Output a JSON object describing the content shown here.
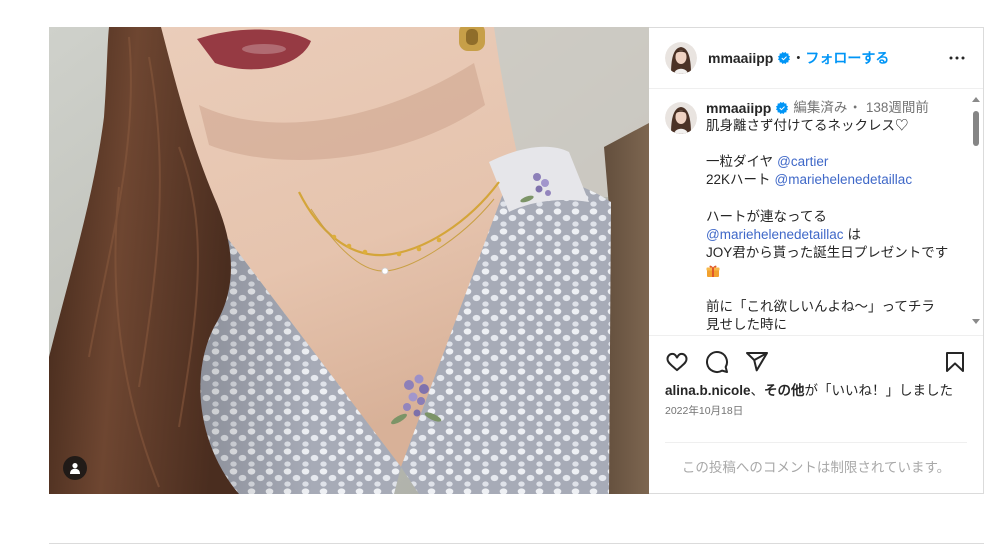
{
  "colors": {
    "accent": "#0095f6",
    "mention": "#3f68c8",
    "text": "#262626",
    "secondary_text": "#737373",
    "border": "#dbdbdb"
  },
  "post": {
    "media": {
      "tag_icon": "user-tag-icon"
    },
    "header": {
      "username": "mmaaiipp",
      "verified_icon": "verified-badge-icon",
      "dot": "・",
      "follow_label": "フォローする",
      "more_icon": "more-options-icon"
    },
    "caption": {
      "username": "mmaaiipp",
      "edited_label": "編集済み",
      "dot": "・",
      "time_ago": "138週間前",
      "line_1": "肌身離さず付けてるネックレス♡",
      "line_2": {
        "text": "一粒ダイヤ",
        "mention": "@cartier"
      },
      "line_3": {
        "text": "22Kハート",
        "mention": "@mariehelenedetaillac"
      },
      "line_4": "ハートが連なってる",
      "line_5": {
        "mention": "@mariehelenedetaillac",
        "text": "は"
      },
      "line_6": "JOY君から貰った誕生日プレゼントです",
      "line_7_icon": "gift-emoji-icon",
      "line_8": "前に「これ欲しいんよね〜」ってチラ",
      "line_9": "見せした時に"
    },
    "actions": {
      "like_icon": "heart-icon",
      "comment_icon": "comment-icon",
      "share_icon": "send-icon",
      "save_icon": "bookmark-icon"
    },
    "likes": {
      "user": "alina.b.nicole",
      "separator": "、",
      "others": "その他",
      "suffix": "が「いいね！」しました"
    },
    "date": "2022年10月18日",
    "comments_restricted": "この投稿へのコメントは制限されています。"
  }
}
